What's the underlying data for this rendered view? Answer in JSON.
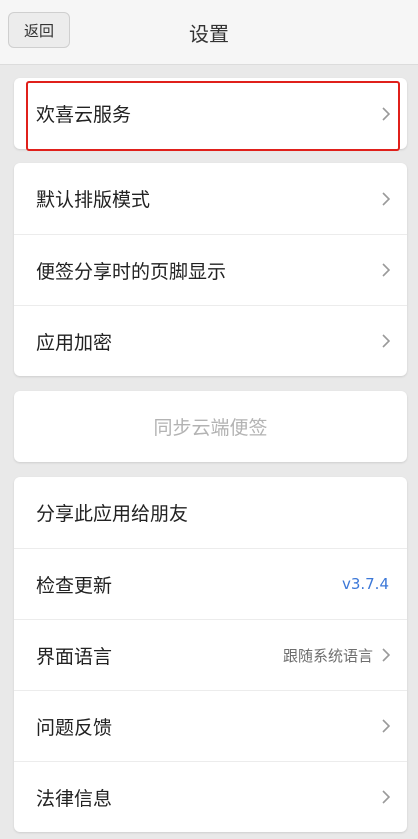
{
  "header": {
    "back_label": "返回",
    "title": "设置"
  },
  "card1": {
    "items": [
      {
        "label": "欢喜云服务",
        "icon": "chevron-right-icon"
      }
    ]
  },
  "card2": {
    "items": [
      {
        "label": "默认排版模式",
        "icon": "chevron-right-icon"
      },
      {
        "label": "便签分享时的页脚显示",
        "icon": "chevron-right-icon"
      },
      {
        "label": "应用加密",
        "icon": "chevron-right-icon"
      }
    ]
  },
  "sync": {
    "label": "同步云端便签"
  },
  "card3": {
    "items": [
      {
        "label": "分享此应用给朋友"
      },
      {
        "label": "检查更新",
        "value": "v3.7.4"
      },
      {
        "label": "界面语言",
        "value": "跟随系统语言",
        "icon": "chevron-right-icon"
      },
      {
        "label": "问题反馈",
        "icon": "chevron-right-icon"
      },
      {
        "label": "法律信息",
        "icon": "chevron-right-icon"
      }
    ]
  },
  "colors": {
    "highlight": "#e0201b",
    "version": "#3c78d8",
    "background": "#e9e9e9"
  }
}
